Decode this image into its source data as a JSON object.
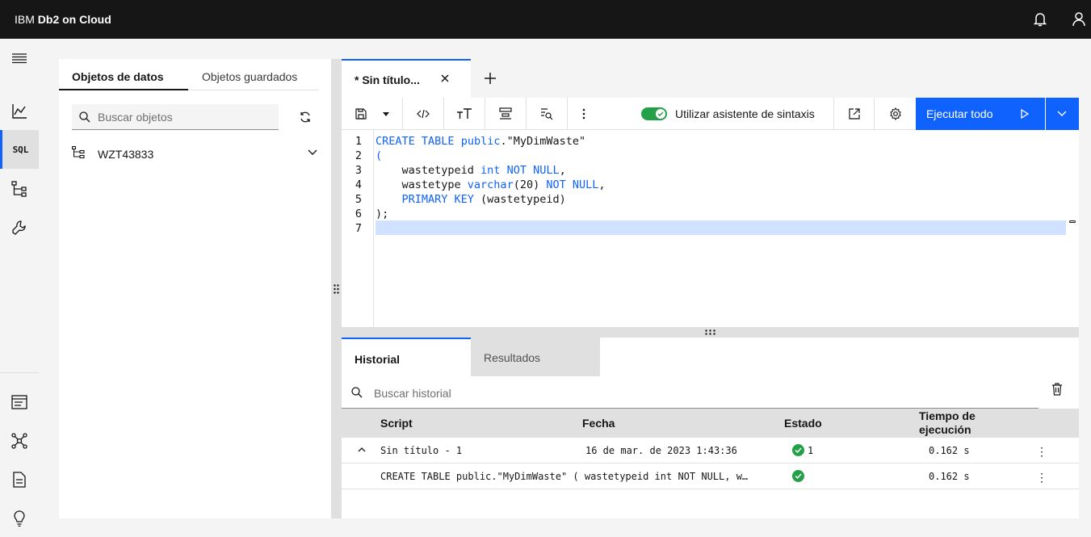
{
  "app": {
    "brand_prefix": "IBM",
    "brand_name": "Db2 on Cloud"
  },
  "left_panel": {
    "tabs": [
      "Objetos de datos",
      "Objetos guardados"
    ],
    "search_placeholder": "Buscar objetos",
    "schema": "WZT43833"
  },
  "rail": {
    "sql_label": "SQL"
  },
  "editor": {
    "tab_title": "* Sin título...",
    "syntax_toggle_label": "Utilizar asistente de sintaxis",
    "run_label": "Ejecutar todo",
    "line_numbers": [
      "1",
      "2",
      "3",
      "4",
      "5",
      "6",
      "7"
    ]
  },
  "bottom": {
    "tabs": [
      "Historial",
      "Resultados"
    ],
    "search_placeholder": "Buscar historial",
    "columns": {
      "script": "Script",
      "date": "Fecha",
      "status": "Estado",
      "time_line1": "Tiempo de",
      "time_line2": "ejecución"
    },
    "rows": [
      {
        "script": "Sin título - 1",
        "date": "16 de mar. de 2023 1:43:36",
        "status_count": "1",
        "time": "0.162 s"
      },
      {
        "script": "CREATE TABLE public.\"MyDimWaste\" ( wastetypeid int NOT NULL, w…",
        "date": "",
        "status_count": "",
        "time": "0.162 s"
      }
    ]
  },
  "colors": {
    "accent": "#0f62fe",
    "success": "#24a148",
    "header": "#161616"
  }
}
